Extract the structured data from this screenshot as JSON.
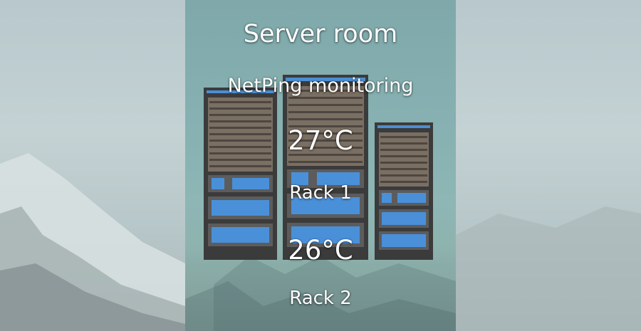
{
  "widget": {
    "title": "Server room",
    "subtitle": "NetPing monitoring",
    "sensors": [
      {
        "temperature": "27°C",
        "label": "Rack 1"
      },
      {
        "temperature": "26°C",
        "label": "Rack 2"
      }
    ]
  },
  "icons": {
    "background": "snowy-mountain-wallpaper",
    "illustration": "server-racks-icon"
  },
  "colors": {
    "panel": "#86b0b1",
    "rack_body": "#3a3a3a",
    "rack_accent": "#4a90d9"
  }
}
